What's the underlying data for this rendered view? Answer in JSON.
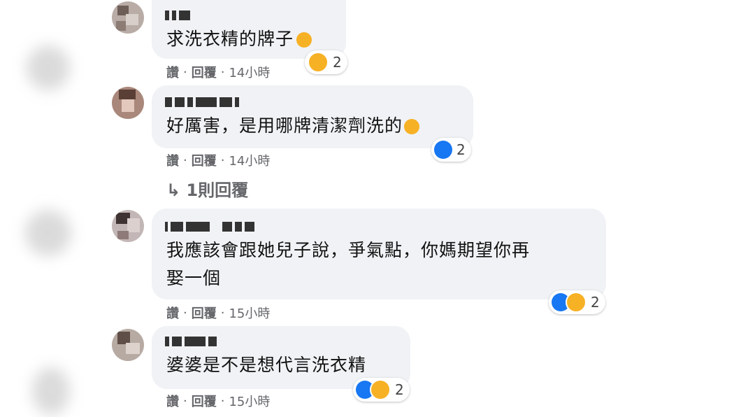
{
  "comments": [
    {
      "text_lines": [
        "求洗衣精的牌子"
      ],
      "emoji": "cry-face",
      "actions": {
        "like": "讚",
        "reply": "回覆",
        "time": "14小時"
      },
      "reaction_count": "2",
      "reaction_icons": [
        "haha"
      ]
    },
    {
      "text_lines": [
        "好厲害，是用哪牌清潔劑洗的"
      ],
      "emoji": "laugh-tears-face",
      "actions": {
        "like": "讚",
        "reply": "回覆",
        "time": "14小時"
      },
      "reaction_count": "2",
      "reaction_icons": [
        "like"
      ]
    },
    {
      "text_lines": [
        "我應該會跟她兒子說，爭氣點，你媽期望你再",
        "娶一個"
      ],
      "actions": {
        "like": "讚",
        "reply": "回覆",
        "time": "15小時"
      },
      "reaction_count": "2",
      "reaction_icons": [
        "like",
        "haha"
      ]
    },
    {
      "text_lines": [
        "婆婆是不是想代言洗衣精"
      ],
      "actions": {
        "like": "讚",
        "reply": "回覆",
        "time": "15小時"
      },
      "reaction_count": "2",
      "reaction_icons": [
        "like",
        "haha"
      ]
    }
  ],
  "replies_link": "↳ 1則回覆",
  "colors": {
    "bubble": "#f0f2f5",
    "like": "#1877f2",
    "haha": "#f7b125",
    "meta": "#65676b"
  }
}
